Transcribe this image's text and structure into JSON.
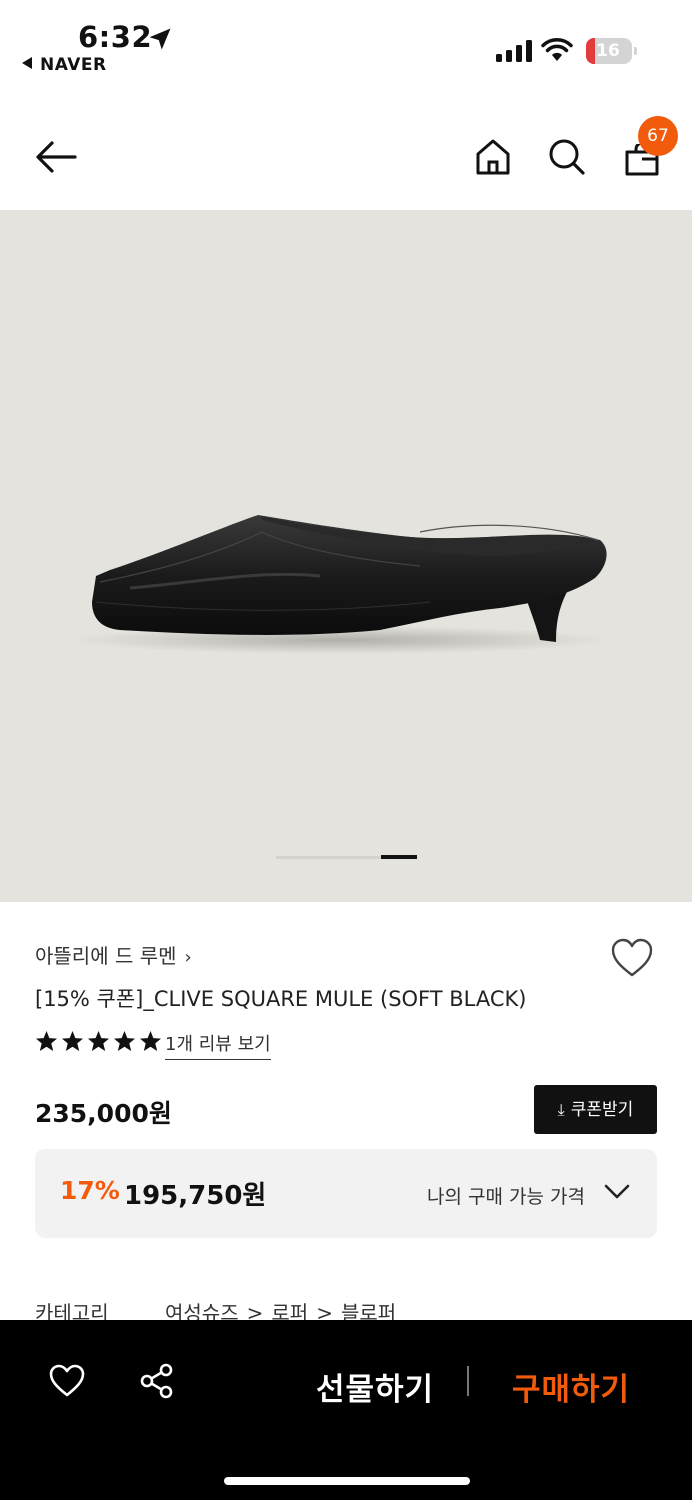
{
  "status_bar": {
    "time": "6:32",
    "back_app": "NAVER",
    "battery": "16"
  },
  "nav": {
    "cart_count": "67"
  },
  "product": {
    "brand": "아뜰리에 드 루멘",
    "title": "[15% 쿠폰]_CLIVE SQUARE MULE (SOFT BLACK)",
    "rating_stars": 5,
    "review_link": "1개 리뷰 보기",
    "price": "235,000원",
    "coupon_button": "쿠폰받기",
    "discount_percent": "17%",
    "discount_price": "195,750원",
    "my_price_label": "나의 구매 가능 가격"
  },
  "image_pager": {
    "total": 2,
    "current": 2
  },
  "category": {
    "label": "카테고리",
    "path": [
      "여성슈즈",
      "로퍼",
      "블로퍼"
    ]
  },
  "bottom_bar": {
    "gift_label": "선물하기",
    "buy_label": "구매하기"
  },
  "colors": {
    "accent": "#f35b0c",
    "hero_background": "#e4e3dd",
    "bottom_bar": "#000000"
  }
}
